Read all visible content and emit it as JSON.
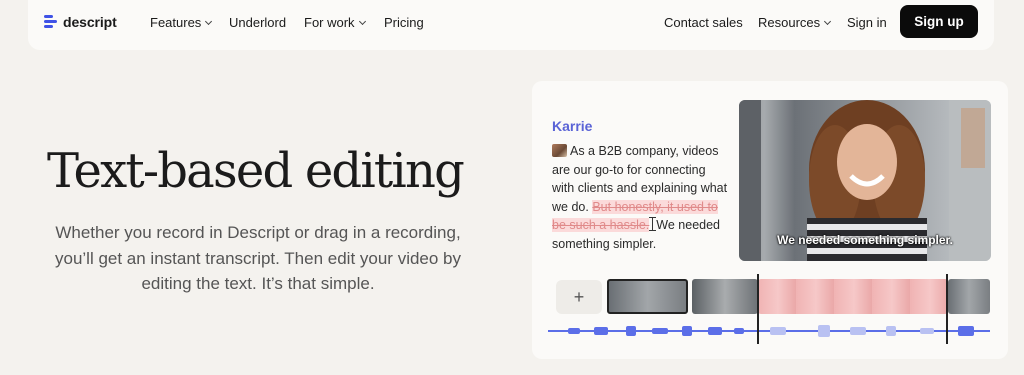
{
  "nav": {
    "logo": "descript",
    "left_items": [
      {
        "label": "Features",
        "dropdown": true
      },
      {
        "label": "Underlord",
        "dropdown": false
      },
      {
        "label": "For work",
        "dropdown": true
      },
      {
        "label": "Pricing",
        "dropdown": false
      }
    ],
    "right_items": [
      {
        "label": "Contact sales",
        "dropdown": false
      },
      {
        "label": "Resources",
        "dropdown": true
      },
      {
        "label": "Sign in",
        "dropdown": false
      }
    ],
    "signup_label": "Sign up"
  },
  "hero": {
    "title": "Text-based editing",
    "subtitle": "Whether you record in Descript or drag in a recording, you’ll get an instant transcript. Then edit your video by editing the text. It’s that simple."
  },
  "demo": {
    "speaker": "Karrie",
    "transcript_kept_1": "As a B2B company, videos are our go-to for connecting with clients and explaining what we do.",
    "transcript_struck": "But honestly, it used to be such a hassle.",
    "transcript_kept_2": "We needed something simpler.",
    "caption": "We needed something simpler.",
    "add_label": "+"
  },
  "colors": {
    "accent": "#3f52e6",
    "speaker": "#5a63d6",
    "strike": "#e08a8a",
    "strike_bg": "#fbdada",
    "waveform": "#5b6ee8"
  }
}
